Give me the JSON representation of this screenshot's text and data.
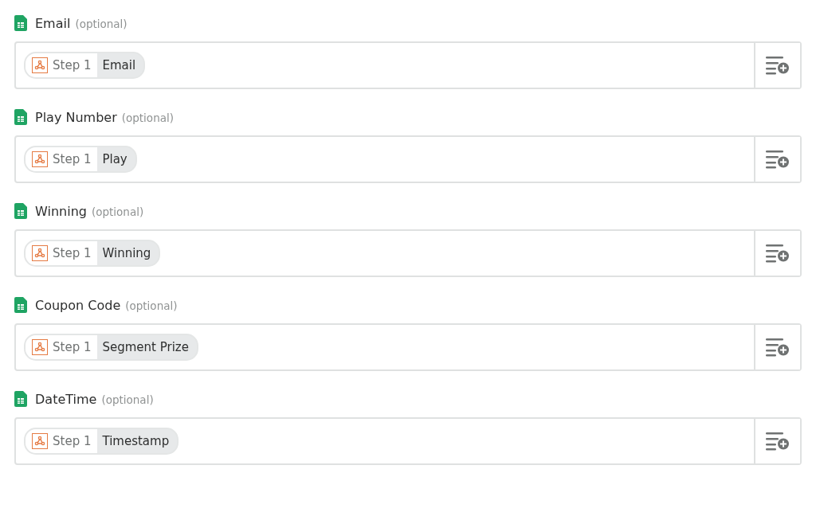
{
  "fields": [
    {
      "label": "Email",
      "hint": "(optional)",
      "token": {
        "step": "Step 1",
        "value": "Email"
      }
    },
    {
      "label": "Play Number",
      "hint": "(optional)",
      "token": {
        "step": "Step 1",
        "value": "Play"
      }
    },
    {
      "label": "Winning",
      "hint": "(optional)",
      "token": {
        "step": "Step 1",
        "value": "Winning"
      }
    },
    {
      "label": "Coupon Code",
      "hint": "(optional)",
      "token": {
        "step": "Step 1",
        "value": "Segment Prize"
      }
    },
    {
      "label": "DateTime",
      "hint": "(optional)",
      "token": {
        "step": "Step 1",
        "value": "Timestamp"
      }
    }
  ]
}
